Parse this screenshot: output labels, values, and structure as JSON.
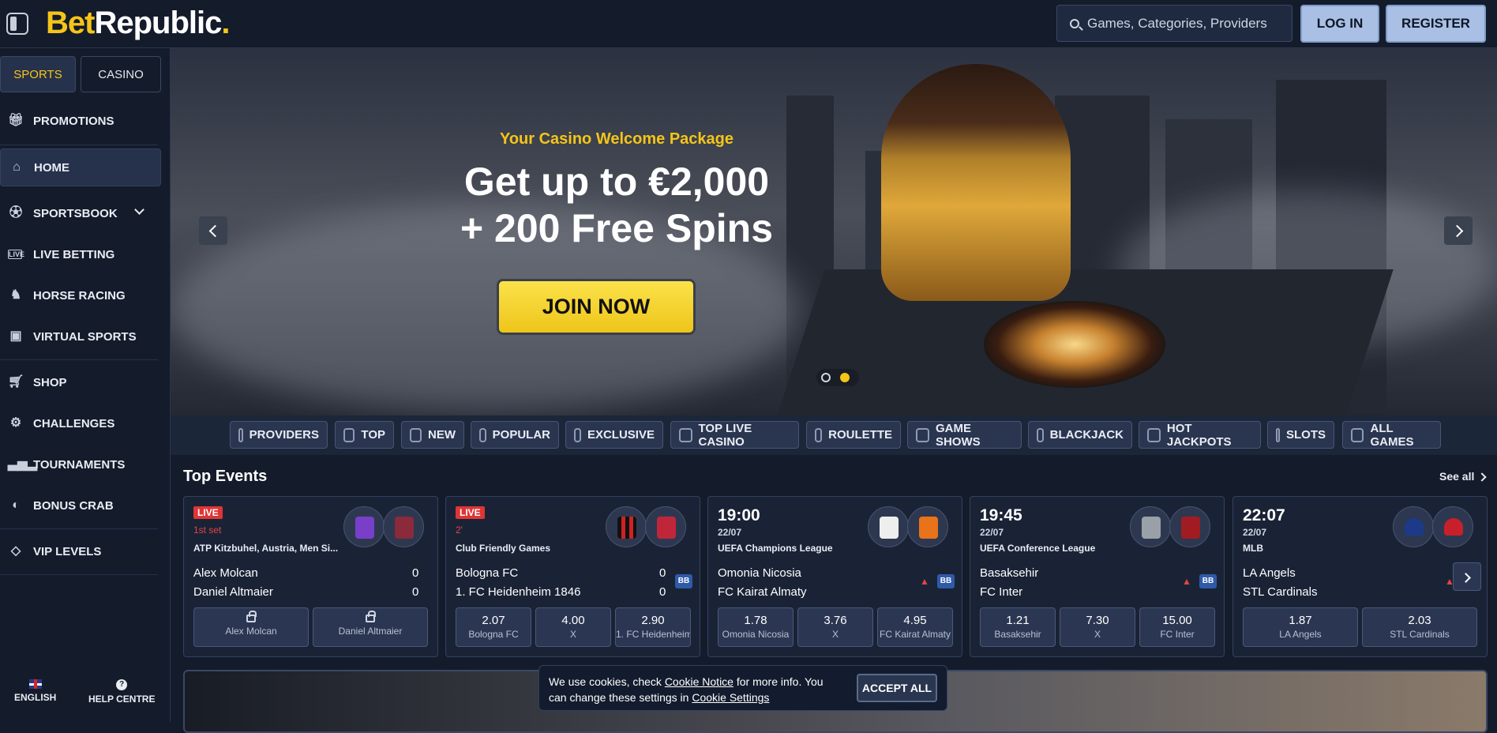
{
  "header": {
    "logo_bet": "Bet",
    "logo_republic": "Republic",
    "logo_dot": ".",
    "search_placeholder": "Games, Categories, Providers",
    "login": "LOG IN",
    "register": "REGISTER"
  },
  "sidebar": {
    "tab_sports": "SPORTS",
    "tab_casino": "CASINO",
    "items": [
      {
        "label": "PROMOTIONS",
        "icon": "gift-icon"
      },
      {
        "label": "HOME",
        "icon": "home-icon"
      },
      {
        "label": "SPORTSBOOK",
        "icon": "soccer-ball-icon"
      },
      {
        "label": "LIVE BETTING",
        "icon": "live-icon"
      },
      {
        "label": "HORSE RACING",
        "icon": "horse-icon"
      },
      {
        "label": "VIRTUAL SPORTS",
        "icon": "virtual-sports-icon"
      },
      {
        "label": "SHOP",
        "icon": "basket-icon"
      },
      {
        "label": "CHALLENGES",
        "icon": "challenge-icon"
      },
      {
        "label": "TOURNAMENTS",
        "icon": "podium-icon"
      },
      {
        "label": "BONUS CRAB",
        "icon": "crab-icon"
      },
      {
        "label": "VIP LEVELS",
        "icon": "diamond-icon"
      }
    ],
    "language": "ENGLISH",
    "help": "HELP CENTRE"
  },
  "hero": {
    "subtitle": "Your Casino Welcome Package",
    "title_line1": "Get up to €2,000",
    "title_line2": "+ 200 Free Spins",
    "cta": "JOIN NOW"
  },
  "categories": [
    "PROVIDERS",
    "TOP",
    "NEW",
    "POPULAR",
    "EXCLUSIVE",
    "TOP LIVE CASINO",
    "ROULETTE",
    "GAME SHOWS",
    "BLACKJACK",
    "HOT JACKPOTS",
    "SLOTS",
    "ALL GAMES"
  ],
  "top_events": {
    "title": "Top Events",
    "see_all": "See all",
    "events": [
      {
        "live": "LIVE",
        "status": "1st set",
        "league": "ATP Kitzbuhel, Austria, Men Si...",
        "home": "Alex Molcan",
        "away": "Daniel Altmaier",
        "home_score": "0",
        "away_score": "0",
        "odds": [
          {
            "name": "Alex Molcan"
          },
          {
            "name": "Daniel Altmaier"
          }
        ]
      },
      {
        "live": "LIVE",
        "status": "2'",
        "league": "Club Friendly Games",
        "home": "Bologna FC",
        "away": "1. FC Heidenheim 1846",
        "home_score": "0",
        "away_score": "0",
        "bb": "BB",
        "odds": [
          {
            "value": "2.07",
            "name": "Bologna FC"
          },
          {
            "value": "4.00",
            "name": "X"
          },
          {
            "value": "2.90",
            "name": "1. FC Heidenheim"
          }
        ]
      },
      {
        "time": "19:00",
        "date": "22/07",
        "league": "UEFA Champions League",
        "home": "Omonia Nicosia",
        "away": "FC Kairat Almaty",
        "bb": "BB",
        "odds": [
          {
            "value": "1.78",
            "name": "Omonia Nicosia"
          },
          {
            "value": "3.76",
            "name": "X"
          },
          {
            "value": "4.95",
            "name": "FC Kairat Almaty"
          }
        ]
      },
      {
        "time": "19:45",
        "date": "22/07",
        "league": "UEFA Conference League",
        "home": "Basaksehir",
        "away": "FC Inter",
        "bb": "BB",
        "odds": [
          {
            "value": "1.21",
            "name": "Basaksehir"
          },
          {
            "value": "7.30",
            "name": "X"
          },
          {
            "value": "15.00",
            "name": "FC Inter"
          }
        ]
      },
      {
        "time": "22:07",
        "date": "22/07",
        "league": "MLB",
        "home": "LA Angels",
        "away": "STL Cardinals",
        "odds": [
          {
            "value": "1.87",
            "name": "LA Angels"
          },
          {
            "value": "2.03",
            "name": "STL Cardinals"
          }
        ]
      }
    ]
  },
  "cookie": {
    "text_a": "We use cookies, check ",
    "link_notice": "Cookie Notice",
    "text_b": " for more info. You can change these settings in ",
    "link_settings": "Cookie Settings",
    "accept": "ACCEPT ALL"
  },
  "colors": {
    "accent": "#f5c518",
    "live": "#e03535",
    "background": "#141c2b"
  }
}
